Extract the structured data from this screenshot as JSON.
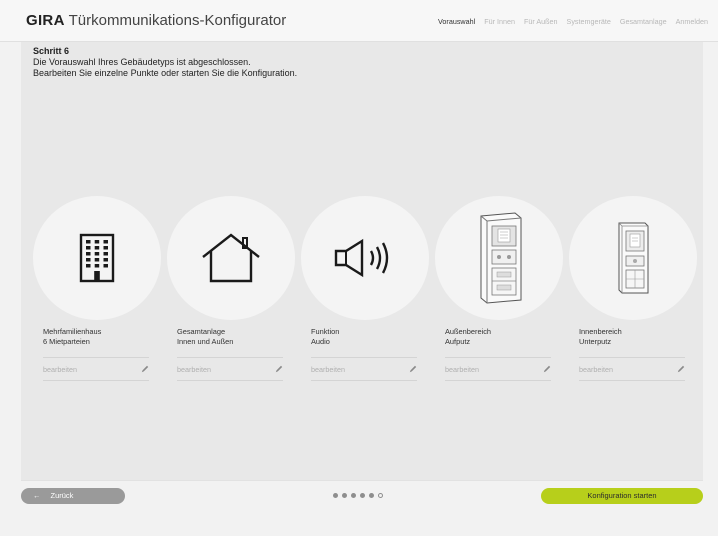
{
  "header": {
    "logo": "GIRA",
    "title": "Türkommunikations-Konfigurator",
    "nav": [
      {
        "label": "Vorauswahl",
        "active": true
      },
      {
        "label": "Für Innen",
        "active": false
      },
      {
        "label": "Für Außen",
        "active": false
      },
      {
        "label": "Systemgeräte",
        "active": false
      },
      {
        "label": "Gesamtanlage",
        "active": false
      },
      {
        "label": "Anmelden",
        "active": false
      }
    ]
  },
  "step": {
    "title": "Schritt 6",
    "line1": "Die Vorauswahl Ihres Gebäudetyps ist abgeschlossen.",
    "line2": "Bearbeiten Sie einzelne Punkte oder starten Sie die Konfiguration."
  },
  "cards": [
    {
      "icon": "apartment-building-icon",
      "line1": "Mehrfamilienhaus",
      "line2": "6 Mietparteien",
      "edit": "bearbeiten"
    },
    {
      "icon": "house-icon",
      "line1": "Gesamtanlage",
      "line2": "Innen und Außen",
      "edit": "bearbeiten"
    },
    {
      "icon": "speaker-audio-icon",
      "line1": "Funktion",
      "line2": "Audio",
      "edit": "bearbeiten"
    },
    {
      "icon": "outdoor-station-icon",
      "line1": "Außenbereich",
      "line2": "Aufputz",
      "edit": "bearbeiten"
    },
    {
      "icon": "indoor-station-icon",
      "line1": "Innenbereich",
      "line2": "Unterputz",
      "edit": "bearbeiten"
    }
  ],
  "footer": {
    "back_label": "Zurück",
    "start_label": "Konfiguration starten",
    "progress": {
      "current": 5,
      "total": 6
    }
  },
  "colors": {
    "accent": "#b7cf1b",
    "back_button": "#9a9a9a",
    "panel": "#e8e8e8"
  }
}
